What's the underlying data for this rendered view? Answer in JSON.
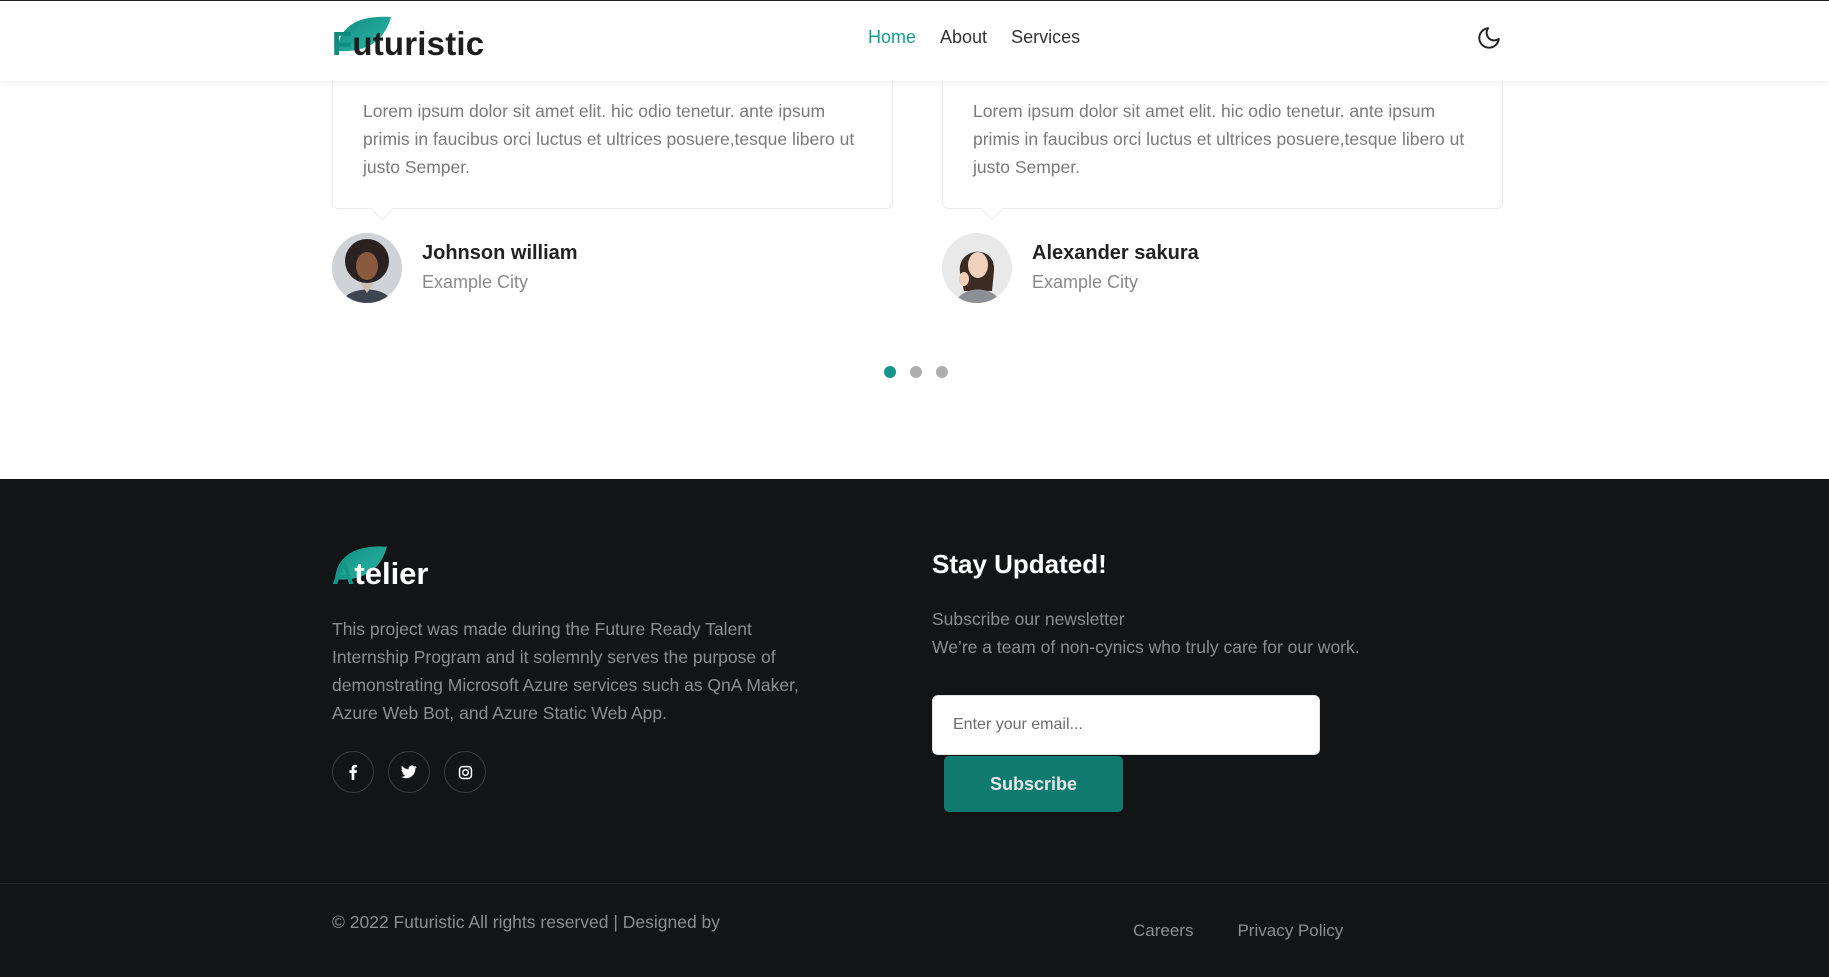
{
  "header": {
    "logo_first_letter": "F",
    "logo_rest": "uturistic",
    "nav": [
      {
        "label": "Home",
        "active": true
      },
      {
        "label": "About",
        "active": false
      },
      {
        "label": "Services",
        "active": false
      }
    ],
    "theme_icon": "moon-icon"
  },
  "testimonials": [
    {
      "text": "Lorem ipsum dolor sit amet elit. hic odio tenetur. ante ipsum primis in faucibus orci luctus et ultrices posuere,tesque libero ut justo Semper.",
      "name": "Johnson william",
      "city": "Example City"
    },
    {
      "text": "Lorem ipsum dolor sit amet elit. hic odio tenetur. ante ipsum primis in faucibus orci luctus et ultrices posuere,tesque libero ut justo Semper.",
      "name": "Alexander sakura",
      "city": "Example City"
    }
  ],
  "carousel": {
    "count": 3,
    "active_index": 0
  },
  "footer": {
    "logo_first_letter": "A",
    "logo_rest": "telier",
    "about": "This project was made during the Future Ready Talent Internship Program and it solemnly serves the purpose of demonstrating Microsoft Azure services such as QnA Maker, Azure Web Bot, and Azure Static Web App.",
    "socials": [
      "facebook-icon",
      "twitter-icon",
      "instagram-icon"
    ],
    "newsletter_title": "Stay Updated!",
    "newsletter_line1": "Subscribe our newsletter",
    "newsletter_line2": "We’re a team of non-cynics who truly care for our work.",
    "email_placeholder": "Enter your email...",
    "subscribe_label": "Subscribe",
    "copyright": "© 2022 Futuristic All rights reserved | Designed by",
    "links": [
      "Careers",
      "Privacy Policy"
    ]
  },
  "colors": {
    "accent": "#179b8f",
    "button": "#0f7b70",
    "footer_bg": "#131416"
  }
}
